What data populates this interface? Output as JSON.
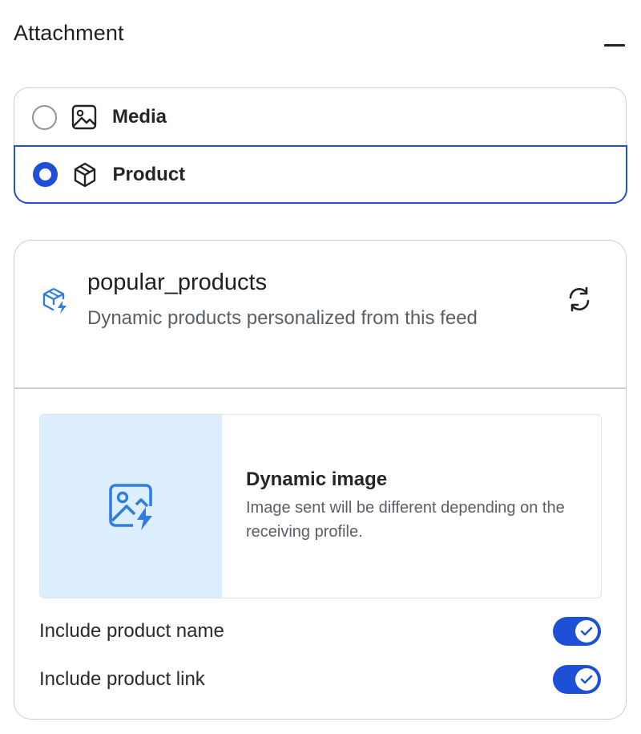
{
  "header": {
    "title": "Attachment",
    "collapse_icon": "minus-icon"
  },
  "attachment_type": {
    "options": [
      {
        "label": "Media",
        "icon": "image-icon",
        "selected": false
      },
      {
        "label": "Product",
        "icon": "cube-icon",
        "selected": true
      }
    ]
  },
  "feed": {
    "icon": "dynamic-product-icon",
    "name": "popular_products",
    "description": "Dynamic products personalized from this feed",
    "refresh_icon": "refresh-icon"
  },
  "dynamic_image": {
    "icon": "dynamic-image-icon",
    "title": "Dynamic image",
    "description": "Image sent will be different depending on the receiving profile."
  },
  "toggles": [
    {
      "label": "Include product name",
      "on": true
    },
    {
      "label": "Include product link",
      "on": true
    }
  ],
  "colors": {
    "accent": "#1d4fd7",
    "thumb_bg": "#ddefff",
    "icon_blue": "#2f7de1",
    "border": "#c9ced6"
  }
}
